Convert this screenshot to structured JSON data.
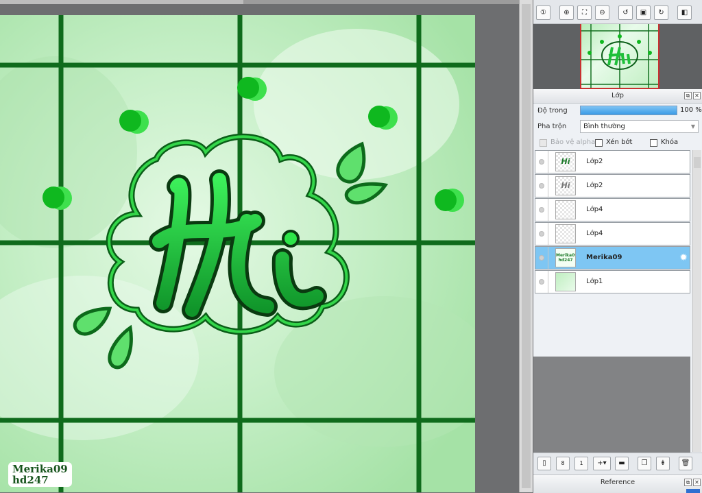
{
  "navigator": {
    "title": ""
  },
  "layers_panel": {
    "title": "Lớp",
    "opacity_label": "Độ trong",
    "opacity_value": "100 %",
    "opacity_fraction": 1.0,
    "blend_label": "Pha trộn",
    "blend_value": "Bình thường",
    "protect_alpha_label": "Bảo vệ alpha",
    "clipping_label": "Xén bớt",
    "lock_label": "Khóa",
    "layers": [
      {
        "name": "Lớp2",
        "selected": false,
        "thumb_text": "Hi"
      },
      {
        "name": "Lớp2",
        "selected": false,
        "thumb_text": "Hi"
      },
      {
        "name": "Lớp4",
        "selected": false,
        "thumb_text": ""
      },
      {
        "name": "Lớp4",
        "selected": false,
        "thumb_text": ""
      },
      {
        "name": "Merika09",
        "selected": true,
        "thumb_text": "Merika09 hd247"
      },
      {
        "name": "Lớp1",
        "selected": false,
        "thumb_text": ""
      }
    ]
  },
  "reference_panel": {
    "title": "Reference"
  },
  "canvas": {
    "lettering": "Hi",
    "watermark_line1": "Merika09",
    "watermark_line2": "hd247"
  },
  "colors": {
    "accent": "#3b9be6",
    "selection": "#7ec6f3",
    "letter_fill": "#22d43c",
    "grid": "#0f6b1c",
    "background_green": "#bdeec0"
  }
}
